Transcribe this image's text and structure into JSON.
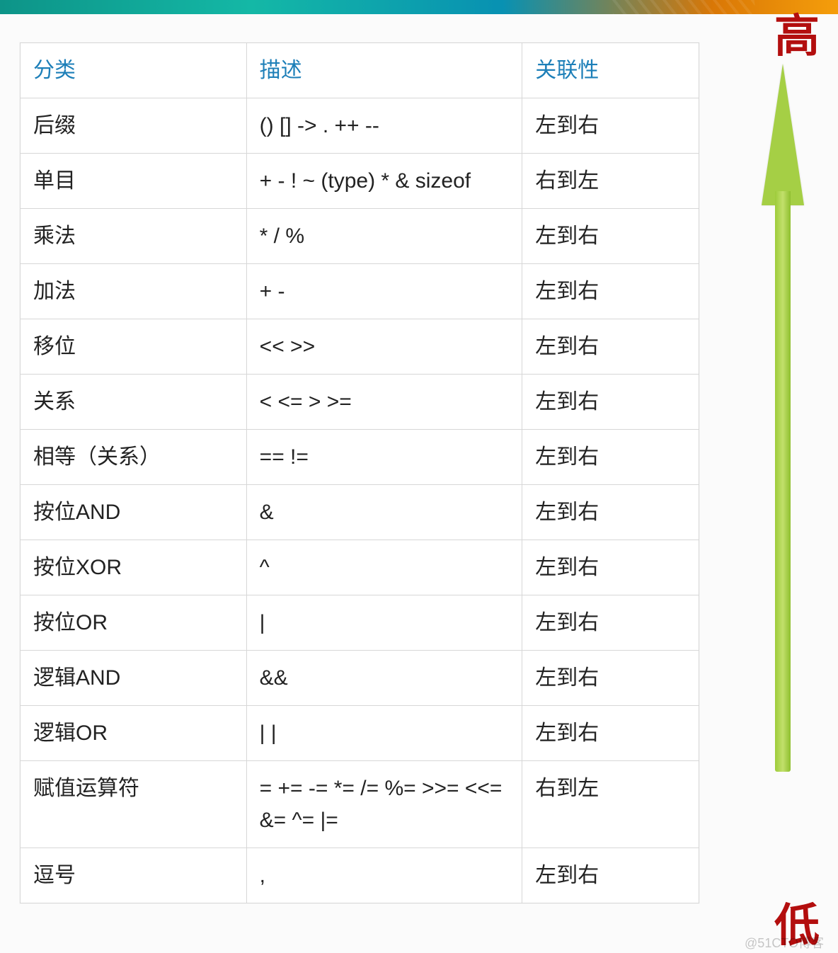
{
  "banner": {},
  "labels": {
    "high": "高",
    "low": "低"
  },
  "table": {
    "headers": {
      "category": "分类",
      "description": "描述",
      "associativity": "关联性"
    },
    "rows": [
      {
        "category": "后缀",
        "description": "() [] -> . ++  --",
        "associativity": "左到右",
        "assoc_dir": "lr"
      },
      {
        "category": "单目",
        "description": "+  -  !  ~  (type) *  &  sizeof",
        "associativity": "右到左",
        "assoc_dir": "rl"
      },
      {
        "category": "乘法",
        "description": "* /  %",
        "associativity": "左到右",
        "assoc_dir": "lr"
      },
      {
        "category": "加法",
        "description": "+  -",
        "associativity": "左到右",
        "assoc_dir": "lr"
      },
      {
        "category": "移位",
        "description": "<<  >>",
        "associativity": "左到右",
        "assoc_dir": "lr"
      },
      {
        "category": "关系",
        "description": "<  <=  >  >=",
        "associativity": "左到右",
        "assoc_dir": "lr"
      },
      {
        "category": "相等（关系）",
        "description": "==  !=",
        "associativity": "左到右",
        "assoc_dir": "lr"
      },
      {
        "category": "按位AND",
        "description": "&",
        "associativity": "左到右",
        "assoc_dir": "lr"
      },
      {
        "category": "按位XOR",
        "description": "^",
        "associativity": "左到右",
        "assoc_dir": "lr"
      },
      {
        "category": "按位OR",
        "description": "|",
        "associativity": "左到右",
        "assoc_dir": "lr"
      },
      {
        "category": "逻辑AND",
        "description": "&&",
        "associativity": "左到右",
        "assoc_dir": "lr"
      },
      {
        "category": "逻辑OR",
        "description": "| |",
        "associativity": "左到右",
        "assoc_dir": "lr"
      },
      {
        "category": "赋值运算符",
        "description": "=  +=   -=  *=   /=  %=   >>=   <<=\n&=  ^=   |=",
        "associativity": "右到左",
        "assoc_dir": "rl"
      },
      {
        "category": "逗号",
        "description": ",",
        "associativity": "左到右",
        "assoc_dir": "lr"
      }
    ]
  },
  "watermark": "@51CTO博客"
}
